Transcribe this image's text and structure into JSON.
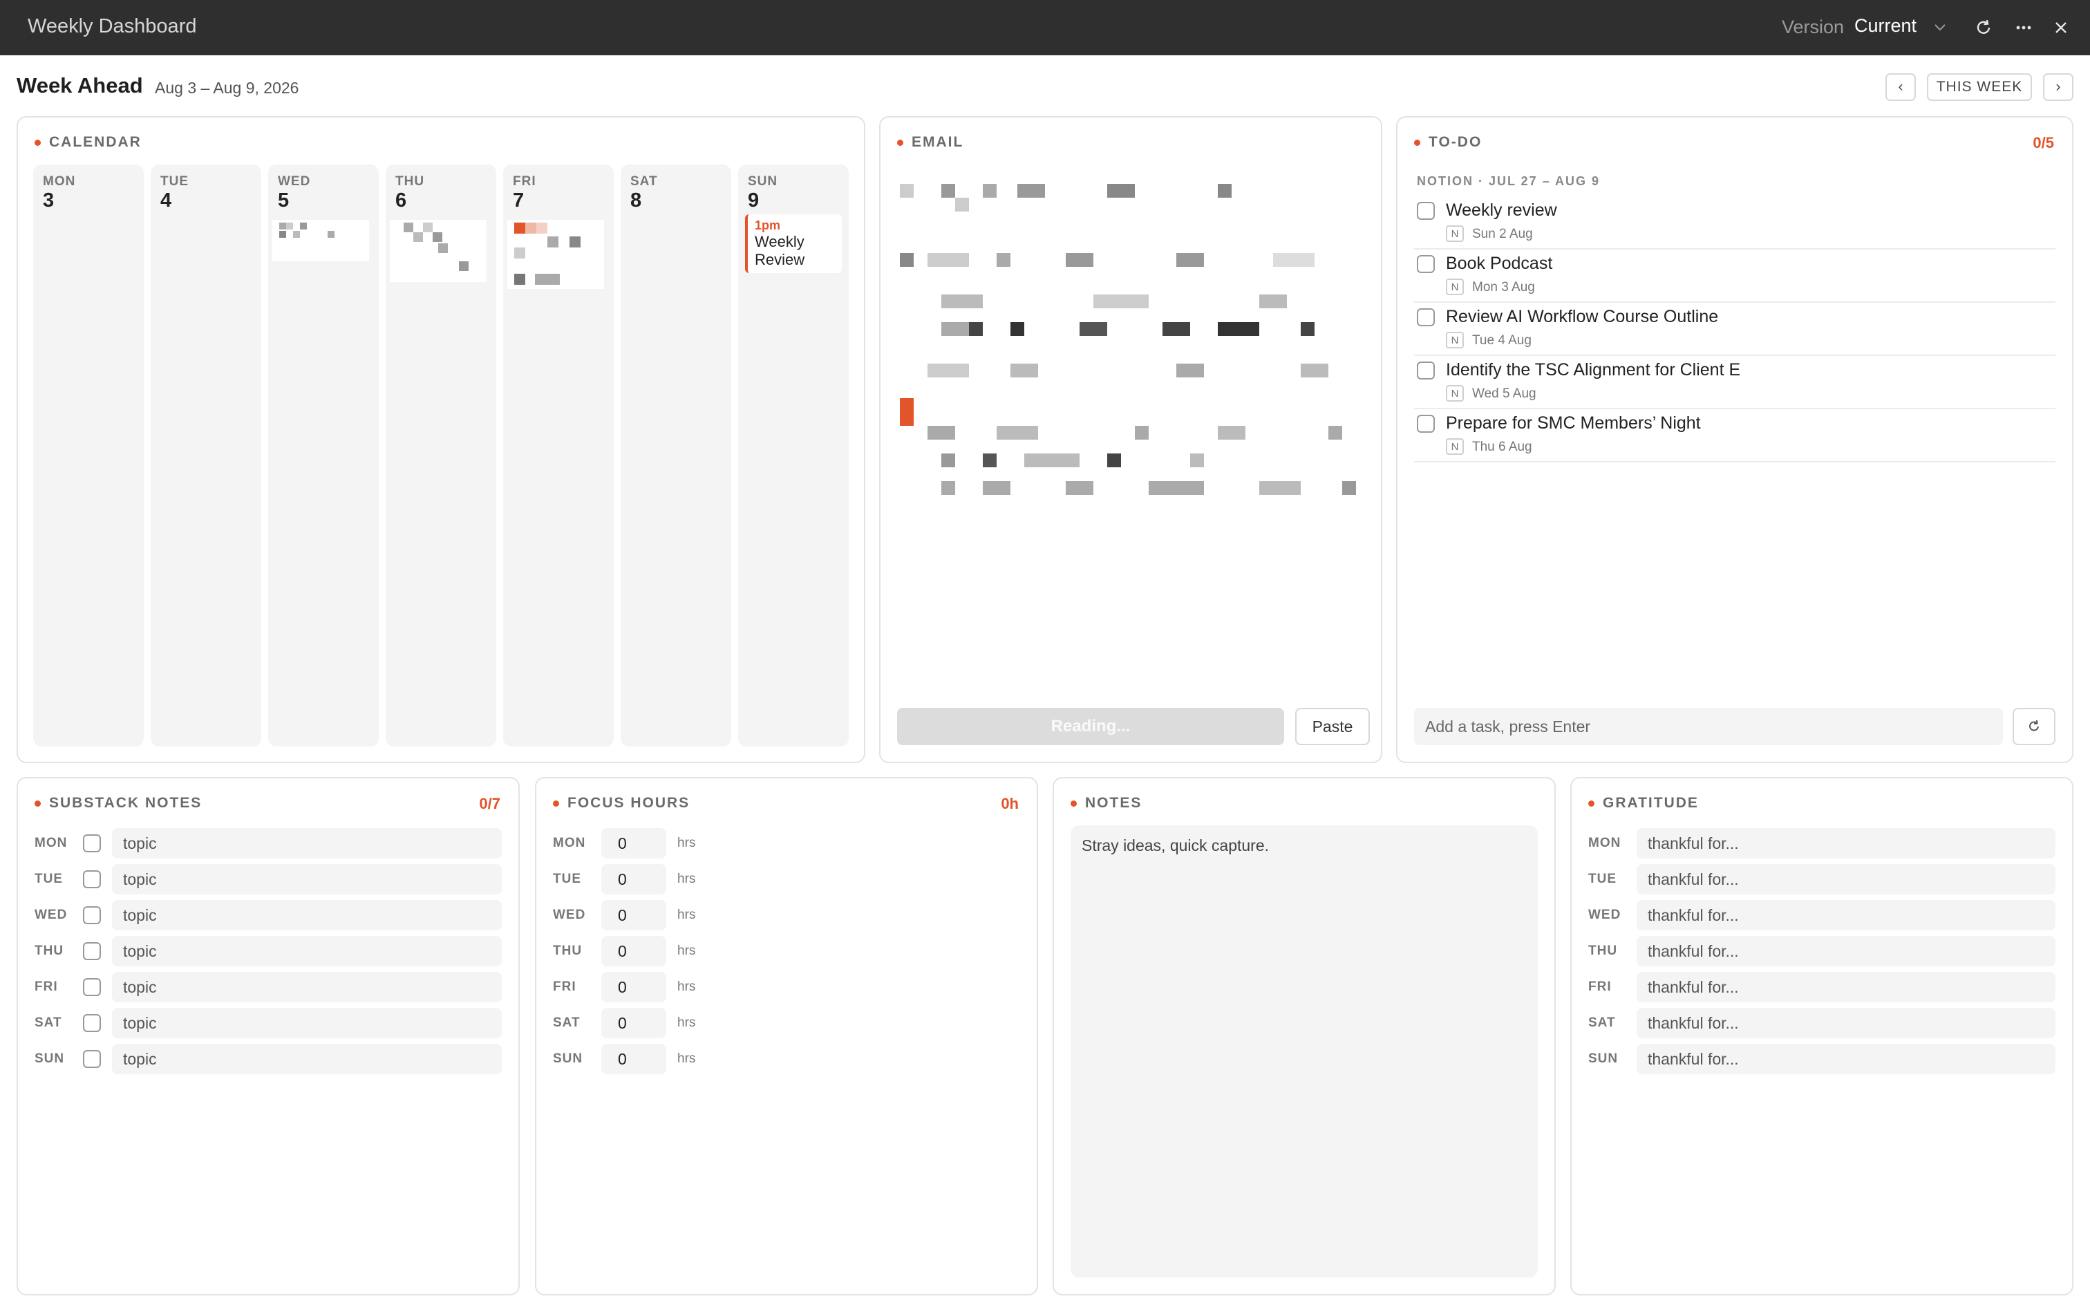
{
  "window": {
    "title": "Weekly Dashboard",
    "version_label": "Version",
    "version_value": "Current"
  },
  "header": {
    "title": "Week Ahead",
    "date_range": "Aug 3 – Aug 9, 2026",
    "prev": "‹",
    "this_week": "THIS WEEK",
    "next": "›"
  },
  "calendar": {
    "title": "CALENDAR",
    "days": [
      {
        "dow": "MON",
        "num": "3"
      },
      {
        "dow": "TUE",
        "num": "4"
      },
      {
        "dow": "WED",
        "num": "5"
      },
      {
        "dow": "THU",
        "num": "6"
      },
      {
        "dow": "FRI",
        "num": "7"
      },
      {
        "dow": "SAT",
        "num": "8"
      },
      {
        "dow": "SUN",
        "num": "9"
      }
    ],
    "event": {
      "time": "1pm",
      "title": "Weekly Review"
    }
  },
  "email": {
    "title": "EMAIL",
    "reading_button": "Reading...",
    "paste_button": "Paste"
  },
  "todo": {
    "title": "TO-DO",
    "count": "0/5",
    "source": "NOTION · JUL 27 – AUG 9",
    "badge": "N",
    "items": [
      {
        "title": "Weekly review",
        "date": "Sun 2 Aug"
      },
      {
        "title": "Book Podcast",
        "date": "Mon 3 Aug"
      },
      {
        "title": "Review AI Workflow Course Outline",
        "date": "Tue 4 Aug"
      },
      {
        "title": "Identify the TSC Alignment for Client E",
        "date": "Wed 5 Aug"
      },
      {
        "title": "Prepare for SMC Members’ Night",
        "date": "Thu 6 Aug"
      }
    ],
    "add_placeholder": "Add a task, press Enter"
  },
  "substack": {
    "title": "SUBSTACK NOTES",
    "count": "0/7",
    "placeholder": "topic",
    "days": [
      "MON",
      "TUE",
      "WED",
      "THU",
      "FRI",
      "SAT",
      "SUN"
    ]
  },
  "focus": {
    "title": "FOCUS HOURS",
    "count": "0h",
    "unit": "hrs",
    "rows": [
      {
        "day": "MON",
        "value": "0"
      },
      {
        "day": "TUE",
        "value": "0"
      },
      {
        "day": "WED",
        "value": "0"
      },
      {
        "day": "THU",
        "value": "0"
      },
      {
        "day": "FRI",
        "value": "0"
      },
      {
        "day": "SAT",
        "value": "0"
      },
      {
        "day": "SUN",
        "value": "0"
      }
    ]
  },
  "notes": {
    "title": "NOTES",
    "placeholder": "Stray ideas, quick capture."
  },
  "gratitude": {
    "title": "GRATITUDE",
    "placeholder": "thankful for...",
    "days": [
      "MON",
      "TUE",
      "WED",
      "THU",
      "FRI",
      "SAT",
      "SUN"
    ]
  },
  "colors": {
    "accent": "#e2542a",
    "titlebar": "#2f2f2f"
  }
}
